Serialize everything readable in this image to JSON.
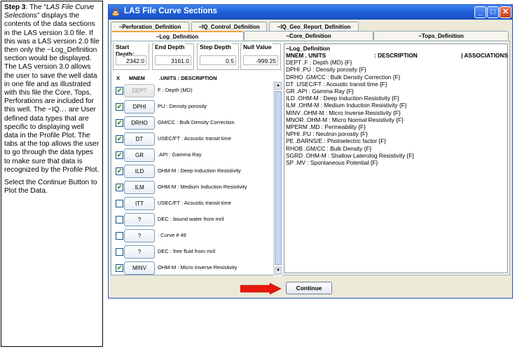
{
  "description": {
    "para1_bold": "Step 3",
    "para1_a": ": The “",
    "para1_italic": "LAS File Curve Selections",
    "para1_b": "” displays the contents of the data sections in the LAS version 3.0 file.  If this was a LAS version 2.0 file then only the ~Log_Definition section would be displayed.  The LAS version 3.0 allows the user to save the well data in one file and as illustrated with this file the Core, Tops, Perforations are included for this well.  The ~IQ… are User defined data types that are specific to displaying well data in the Profile Plot.  The tabs at the top allows the user to go through the data types to make sure that data is recognized by the Profile Plot.",
    "para2": "Select the Continue Button to Plot the Data."
  },
  "window": {
    "title": "LAS File Curve Sections",
    "minimize_label": "_",
    "maximize_label": "□",
    "close_label": "✕"
  },
  "tabs": {
    "row1": [
      "~Perforation_Definition",
      "~IQ_Control_Definition",
      "~IQ_Geo_Report_Definition"
    ],
    "row2": [
      "~Log_Definition",
      "~Core_Definition",
      "~Tops_Definition"
    ]
  },
  "depth": {
    "start_label": "Start Depth:",
    "start_value": "2342.0",
    "end_label": "End Depth",
    "end_value": "3161.0",
    "step_label": "Step Depth",
    "step_value": "0.5",
    "null_label": "Null Value",
    "null_value": "-999.25"
  },
  "columns": {
    "x": "X",
    "mnem": "MNEM",
    "units": ".UNITS  : DESCRIPTION"
  },
  "curves": [
    {
      "checked": true,
      "mnem": "DEPT",
      "disabled": true,
      "desc": "F : Depth (MD)"
    },
    {
      "checked": true,
      "mnem": "DPHI",
      "disabled": false,
      "desc": "PU : Density porosity"
    },
    {
      "checked": true,
      "mnem": "DRHO",
      "disabled": false,
      "desc": "GM/CC : Bulk Density Correction"
    },
    {
      "checked": true,
      "mnem": "DT",
      "disabled": false,
      "desc": "USEC/FT : Acoustic transit time"
    },
    {
      "checked": true,
      "mnem": "GR",
      "disabled": false,
      "desc": ".API : Gamma Ray"
    },
    {
      "checked": true,
      "mnem": "ILD",
      "disabled": false,
      "desc": "OHM-M : Deep Induction Resistivity"
    },
    {
      "checked": true,
      "mnem": "ILM",
      "disabled": false,
      "desc": "OHM-M : Medium Induction Resistivity"
    },
    {
      "checked": false,
      "mnem": "ITT",
      "disabled": false,
      "desc": "USEC/FT : Acoustic transit time"
    },
    {
      "checked": false,
      "mnem": "?",
      "disabled": false,
      "desc": "DEC : bound water from mril"
    },
    {
      "checked": false,
      "mnem": "?",
      "disabled": false,
      "desc": ": Curve # 49"
    },
    {
      "checked": false,
      "mnem": "?",
      "disabled": false,
      "desc": "DEC : free fluid from mril"
    },
    {
      "checked": true,
      "mnem": "MINV",
      "disabled": false,
      "desc": "OHM-M : Micro Inverse Resistivity"
    }
  ],
  "textarea": {
    "title": "~Log_Definition",
    "header_mnem": "MNEM . UNITS",
    "header_desc": ": DESCRIPTION",
    "header_assoc": "| ASSOCIATIONS",
    "lines": [
      "DEPT .F    : Depth (MD)  {F}",
      "DPHI .PU    : Density porosity  {F}",
      "DRHO .GM/CC    : Bulk Density Correction  {F}",
      "DT .USEC/FT    : Acoustic transit time  {F}",
      "GR .API    : Gamma Ray  {F}",
      "ILD .OHM-M    : Deep Induction Resistivity  {F}",
      "ILM .OHM-M    : Medium Induction Resistivity  {F}",
      "MINV .OHM-M    : Micro Inverse Resistivity  {F}",
      "MNOR .OHM-M    : Micro Normal Resistivity  {F}",
      "MPERM .MD    : Permeability  {F}",
      "NPHI .PU    : Neutron porosity  {F}",
      "PE .BARNS/E    : Photoelectric factor  {F}",
      "RHOB .GM/CC    : Bulk Density  {F}",
      "SGRD .OHM-M    : Shallow Laterolog Resistivity  {F}",
      "SP .MV    : Spontaneous Potential  {F}"
    ]
  },
  "continue_label": "Continue",
  "colors": {
    "arrow": "#e8180c",
    "title_bar": "#1f5fd8",
    "active_tab": "#f0a040"
  }
}
